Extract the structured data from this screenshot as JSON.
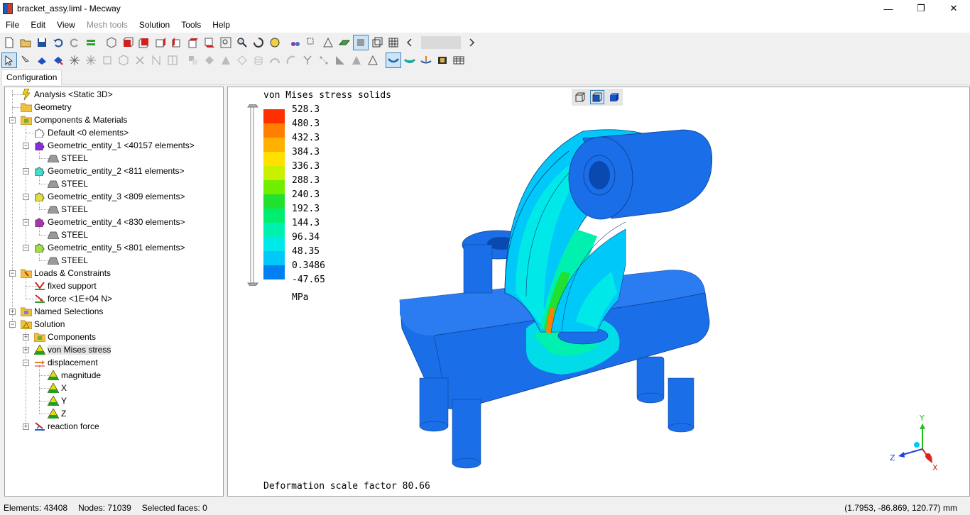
{
  "window": {
    "title": "bracket_assy.liml - Mecway"
  },
  "menu": [
    {
      "label": "File",
      "enabled": true
    },
    {
      "label": "Edit",
      "enabled": true
    },
    {
      "label": "View",
      "enabled": true
    },
    {
      "label": "Mesh tools",
      "enabled": false
    },
    {
      "label": "Solution",
      "enabled": true
    },
    {
      "label": "Tools",
      "enabled": true
    },
    {
      "label": "Help",
      "enabled": true
    }
  ],
  "tab": {
    "label": "Configuration"
  },
  "tree": {
    "analysis": "Analysis <Static 3D>",
    "geometry": "Geometry",
    "components_materials": "Components & Materials",
    "default": "Default <0 elements>",
    "entities": [
      {
        "label": "Geometric_entity_1 <40157 elements>",
        "material": "STEEL",
        "color": "#8a2be2"
      },
      {
        "label": "Geometric_entity_2 <811 elements>",
        "material": "STEEL",
        "color": "#40e0d0"
      },
      {
        "label": "Geometric_entity_3 <809 elements>",
        "material": "STEEL",
        "color": "#e0e040"
      },
      {
        "label": "Geometric_entity_4 <830 elements>",
        "material": "STEEL",
        "color": "#b030b0"
      },
      {
        "label": "Geometric_entity_5 <801 elements>",
        "material": "STEEL",
        "color": "#a0e040"
      }
    ],
    "loads_constraints": "Loads & Constraints",
    "fixed_support": "fixed support",
    "force": "force <1E+04 N>",
    "named_selections": "Named Selections",
    "solution": "Solution",
    "components": "Components",
    "von_mises": "von Mises stress",
    "displacement": "displacement",
    "magnitude": "magnitude",
    "x": "X",
    "y": "Y",
    "z": "Z",
    "reaction_force": "reaction force"
  },
  "viewport": {
    "title": "von Mises stress solids",
    "legend_values": [
      "528.3",
      "480.3",
      "432.3",
      "384.3",
      "336.3",
      "288.3",
      "240.3",
      "192.3",
      "144.3",
      "96.34",
      "48.35",
      "0.3486",
      "-47.65"
    ],
    "legend_colors": [
      "#ff3000",
      "#ff8000",
      "#ffb000",
      "#ffe000",
      "#c8f000",
      "#70ee00",
      "#20e030",
      "#00ee70",
      "#00f0b0",
      "#00e8e8",
      "#00c8f8",
      "#0080f0",
      "#0040e8"
    ],
    "unit": "MPa",
    "deformation": "Deformation scale factor 80.66",
    "axes": {
      "x": "X",
      "y": "Y",
      "z": "Z"
    }
  },
  "status": {
    "elements": "Elements: 43408",
    "nodes": "Nodes: 71039",
    "selected": "Selected faces: 0",
    "coords": "(1.7953, -86.869, 120.77) mm"
  }
}
